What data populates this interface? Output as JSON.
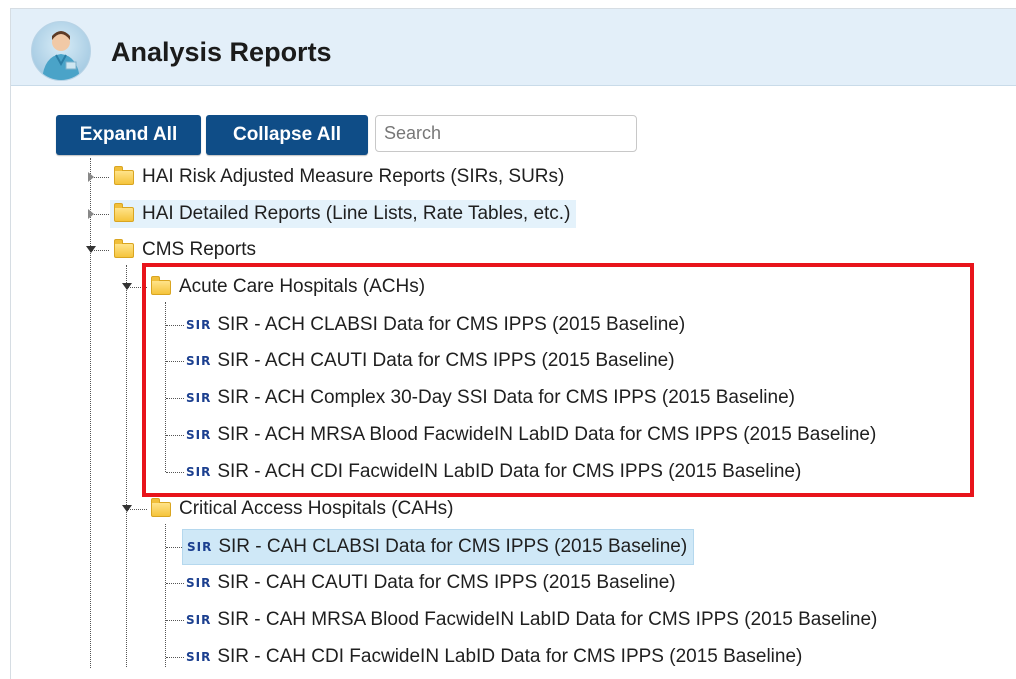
{
  "header": {
    "title": "Analysis Reports"
  },
  "toolbar": {
    "expand_label": "Expand All",
    "collapse_label": "Collapse All",
    "search_placeholder": "Search"
  },
  "tree": {
    "top": [
      "HAI Risk Adjusted Measure Reports (SIRs, SURs)",
      "HAI Detailed Reports (Line Lists, Rate Tables, etc.)",
      "CMS Reports"
    ],
    "ach_folder": "Acute Care Hospitals (ACHs)",
    "ach_reports": [
      "SIR - ACH CLABSI Data for CMS IPPS (2015 Baseline)",
      "SIR - ACH CAUTI Data for CMS IPPS (2015 Baseline)",
      "SIR - ACH Complex 30-Day SSI Data for CMS IPPS (2015 Baseline)",
      "SIR - ACH MRSA Blood FacwideIN LabID Data for CMS IPPS (2015 Baseline)",
      "SIR - ACH CDI FacwideIN LabID Data for CMS IPPS (2015 Baseline)"
    ],
    "cah_folder": "Critical Access Hospitals (CAHs)",
    "cah_reports": [
      "SIR - CAH CLABSI Data for CMS IPPS (2015 Baseline)",
      "SIR - CAH CAUTI Data for CMS IPPS (2015 Baseline)",
      "SIR - CAH MRSA Blood FacwideIN LabID Data for CMS IPPS (2015 Baseline)",
      "SIR - CAH CDI FacwideIN LabID Data for CMS IPPS (2015 Baseline)"
    ],
    "report_icon_text": "SIR"
  },
  "colors": {
    "accent": "#0f4d87",
    "header_bg": "#e3eff9",
    "highlight_box": "#e8141b",
    "selected_row": "#cfe8f7"
  }
}
